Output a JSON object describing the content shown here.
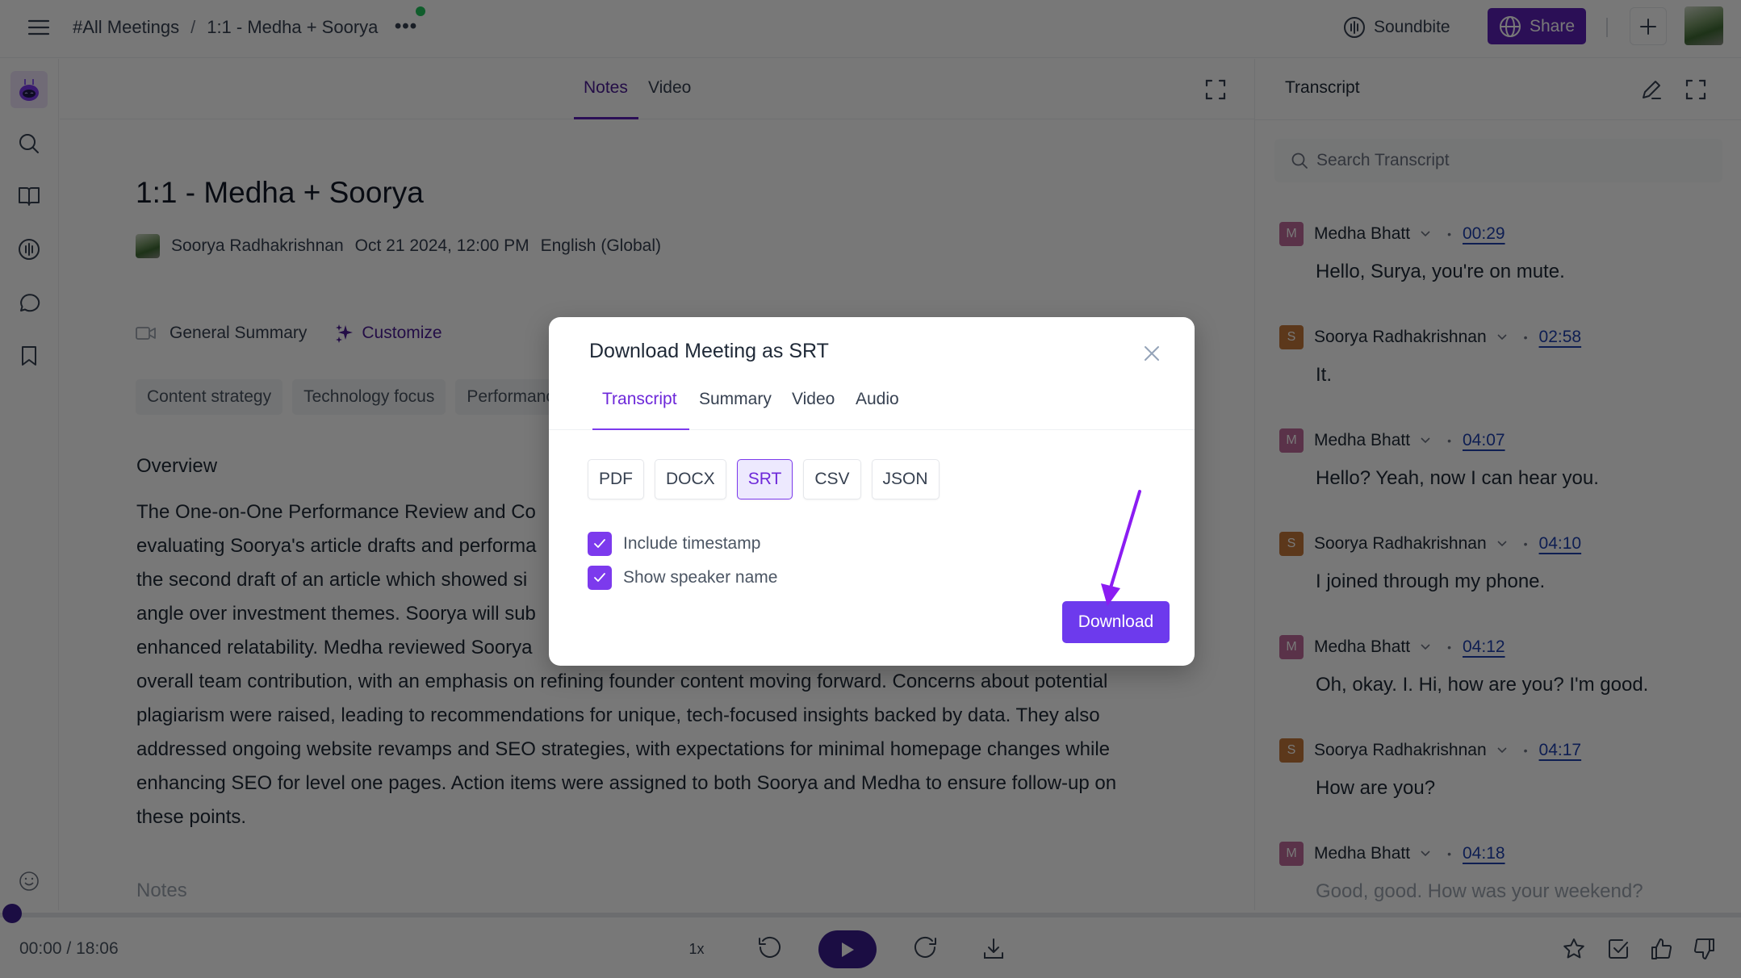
{
  "header": {
    "breadcrumb": [
      "#All Meetings",
      "1:1 - Medha + Soorya"
    ],
    "breadcrumb_separator": "/",
    "more_label": "•••",
    "soundbite_label": "Soundbite",
    "share_label": "Share",
    "status_color": "#22c55e"
  },
  "rail": {
    "items": [
      "search-icon",
      "book-icon",
      "soundbite-icon",
      "chat-icon",
      "bookmark-icon"
    ],
    "footer_icon": "smiley-icon"
  },
  "notes_panel": {
    "tabs": [
      {
        "label": "Notes",
        "active": true
      },
      {
        "label": "Video",
        "active": false
      }
    ],
    "title": "1:1 - Medha + Soorya",
    "owner": "Soorya Radhakrishnan",
    "datetime": "Oct 21 2024, 12:00 PM",
    "language": "English (Global)",
    "summary_template": "General Summary",
    "customize_label": "Customize",
    "topic_chips": [
      "Content strategy",
      "Technology focus",
      "Performance"
    ],
    "overview_heading": "Overview",
    "overview_lines": [
      "The One-on-One Performance Review and Co",
      "evaluating Soorya's article drafts and performa",
      "the second draft of an article which showed si",
      "angle over investment themes. Soorya will sub",
      "enhanced relatability. Medha reviewed Soorya",
      "overall team contribution, with an emphasis on refining founder content moving forward. Concerns about potential",
      "plagiarism were raised, leading to recommendations for unique, tech-focused insights backed by data. They also",
      "addressed ongoing website revamps and SEO strategies, with expectations for minimal homepage changes while",
      "enhancing SEO for level one pages. Action items were assigned to both Soorya and Medha to ensure follow-up on",
      "these points."
    ],
    "notes_heading": "Notes"
  },
  "transcript": {
    "title": "Transcript",
    "search_placeholder": "Search Transcript",
    "entries": [
      {
        "initial": "M",
        "speaker": "Medha Bhatt",
        "time": "00:29",
        "text": "Hello, Surya, you're on mute.",
        "color": "#c06a9b"
      },
      {
        "initial": "S",
        "speaker": "Soorya Radhakrishnan",
        "time": "02:58",
        "text": "It.",
        "color": "#c4773a"
      },
      {
        "initial": "M",
        "speaker": "Medha Bhatt",
        "time": "04:07",
        "text": "Hello? Yeah, now I can hear you.",
        "color": "#c06a9b"
      },
      {
        "initial": "S",
        "speaker": "Soorya Radhakrishnan",
        "time": "04:10",
        "text": "I joined through my phone.",
        "color": "#c4773a"
      },
      {
        "initial": "M",
        "speaker": "Medha Bhatt",
        "time": "04:12",
        "text": "Oh, okay. I. Hi, how are you? I'm good.",
        "color": "#c06a9b"
      },
      {
        "initial": "S",
        "speaker": "Soorya Radhakrishnan",
        "time": "04:17",
        "text": "How are you?",
        "color": "#c4773a"
      },
      {
        "initial": "M",
        "speaker": "Medha Bhatt",
        "time": "04:18",
        "text": "Good, good. How was your weekend?",
        "color": "#c06a9b"
      }
    ]
  },
  "player": {
    "current_time": "00:00",
    "duration": "18:06",
    "time_separator": "/",
    "speed": "1x",
    "progress_fraction": 0.0
  },
  "modal": {
    "title": "Download Meeting as SRT",
    "tabs": [
      {
        "label": "Transcript",
        "active": true
      },
      {
        "label": "Summary",
        "active": false
      },
      {
        "label": "Video",
        "active": false
      },
      {
        "label": "Audio",
        "active": false
      }
    ],
    "formats": [
      {
        "label": "PDF",
        "selected": false
      },
      {
        "label": "DOCX",
        "selected": false
      },
      {
        "label": "SRT",
        "selected": true
      },
      {
        "label": "CSV",
        "selected": false
      },
      {
        "label": "JSON",
        "selected": false
      }
    ],
    "options": [
      {
        "label": "Include timestamp",
        "checked": true
      },
      {
        "label": "Show speaker name",
        "checked": true
      }
    ],
    "download_label": "Download",
    "accent_color": "#7c3aed"
  }
}
